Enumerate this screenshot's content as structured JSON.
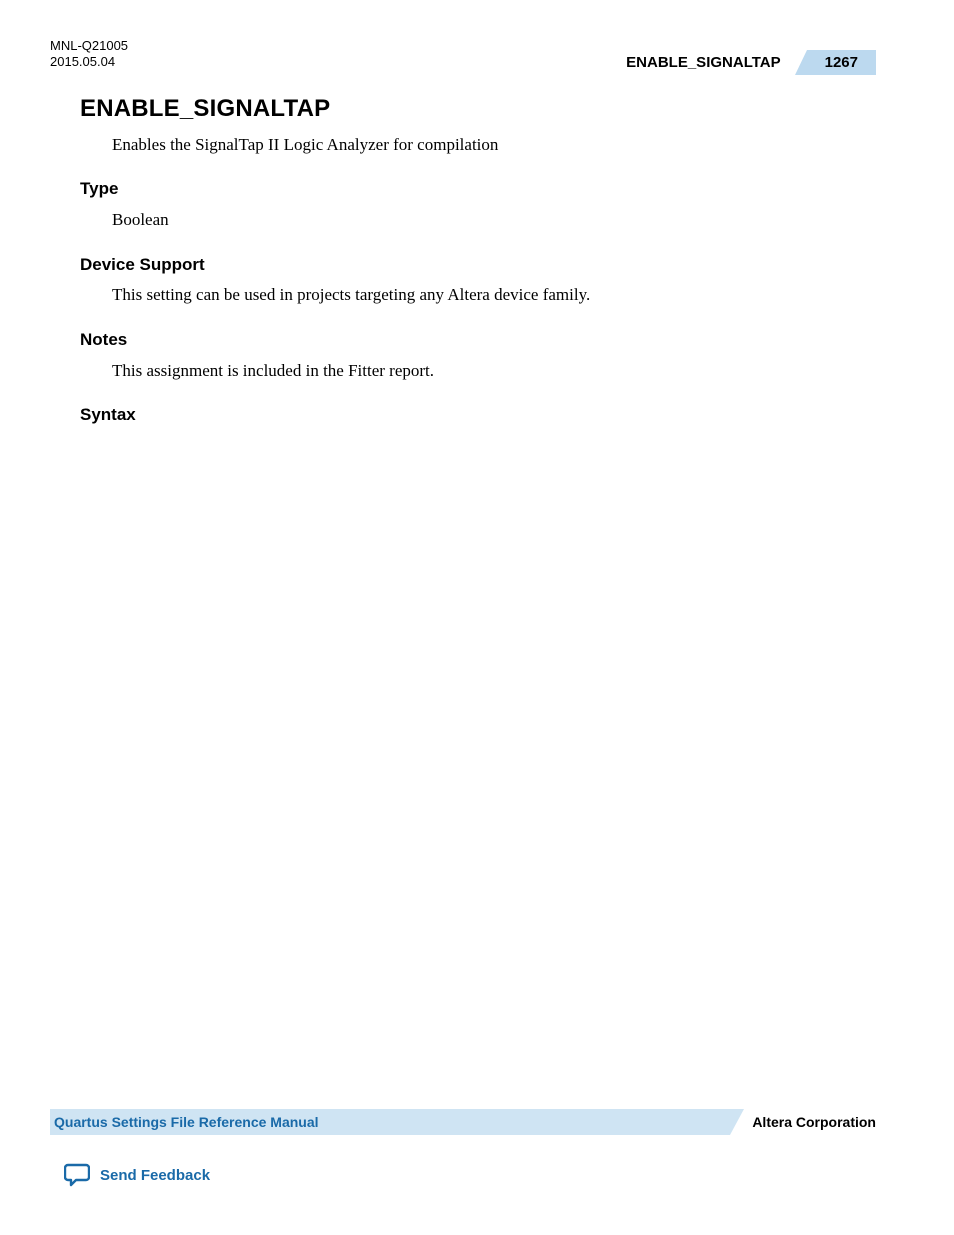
{
  "header": {
    "doc_id": "MNL-Q21005",
    "date": "2015.05.04",
    "section_title": "ENABLE_SIGNALTAP",
    "page_number": "1267"
  },
  "main": {
    "heading": "ENABLE_SIGNALTAP",
    "intro": "Enables the SignalTap II Logic Analyzer for compilation",
    "sections": {
      "type": {
        "label": "Type",
        "text": "Boolean"
      },
      "device_support": {
        "label": "Device Support",
        "text": "This setting can be used in projects targeting any Altera device family."
      },
      "notes": {
        "label": "Notes",
        "text": "This assignment is included in the Fitter report."
      },
      "syntax": {
        "label": "Syntax"
      }
    }
  },
  "footer": {
    "manual_title": "Quartus Settings File Reference Manual",
    "company": "Altera Corporation",
    "feedback_label": "Send Feedback"
  }
}
